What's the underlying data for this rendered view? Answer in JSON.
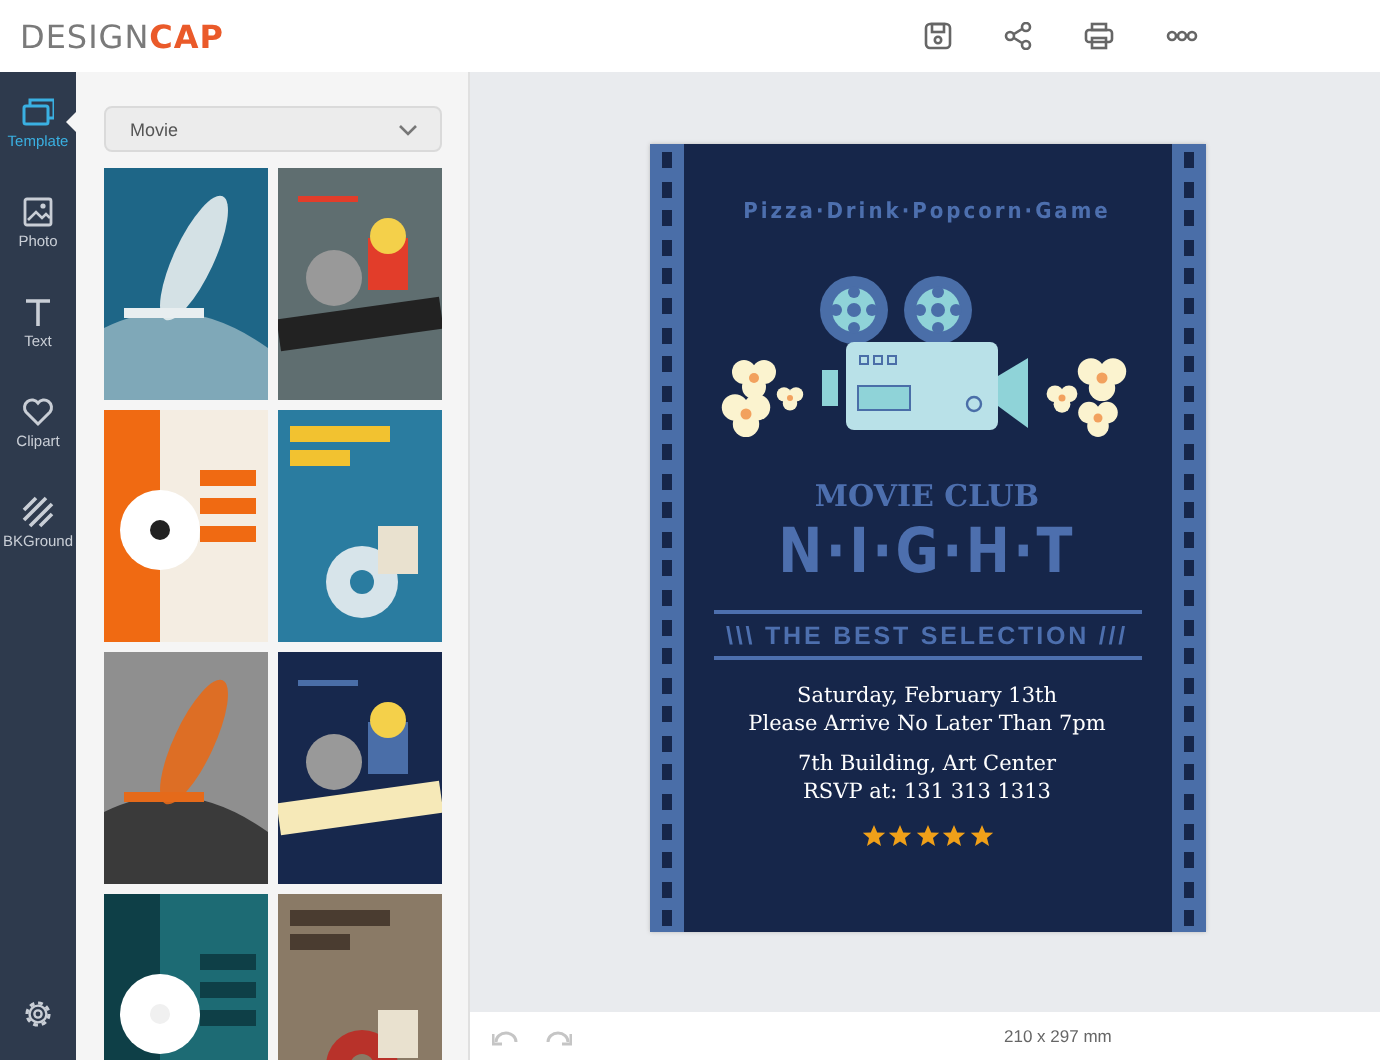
{
  "logo": {
    "text": "DESIGN",
    "accent": "CAP"
  },
  "rail": [
    {
      "label": "Template",
      "selected": true
    },
    {
      "label": "Photo",
      "selected": false
    },
    {
      "label": "Text",
      "selected": false
    },
    {
      "label": "Clipart",
      "selected": false
    },
    {
      "label": "BKGround",
      "selected": false
    }
  ],
  "category_select": {
    "value": "Movie"
  },
  "poster": {
    "tagline": "Pizza·Drink·Popcorn·Game",
    "subtitle": "MOVIE CLUB",
    "title": "N·I·G·H·T",
    "banner": "\\\\\\ THE BEST SELECTION ///",
    "lines": [
      "Saturday, February 13th",
      "Please Arrive No Later Than 7pm",
      "7th Building, Art Center",
      "RSVP at: 131 313 1313"
    ],
    "stars": 5
  },
  "history": {
    "undo_disabled": true,
    "redo_disabled": true
  },
  "size_label": "210 x 297 mm"
}
